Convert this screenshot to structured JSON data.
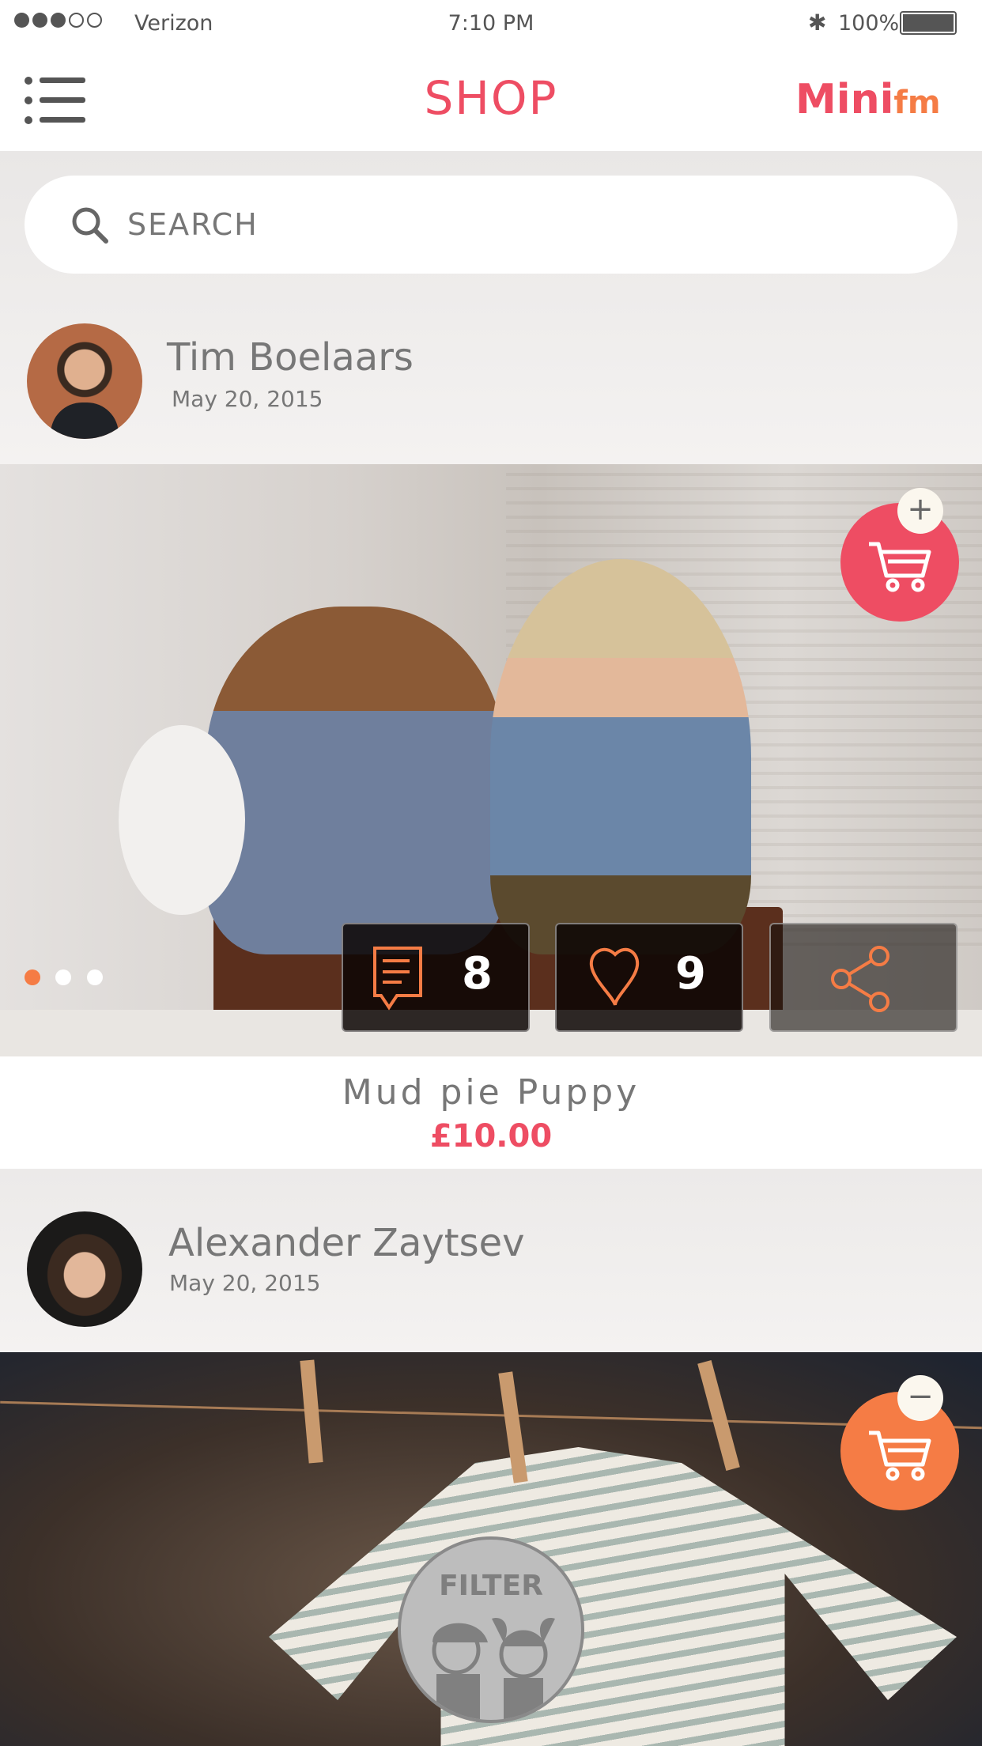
{
  "status": {
    "carrier": "Verizon",
    "signal_bars": 3,
    "time": "7:10 PM",
    "battery": "100%"
  },
  "header": {
    "title": "SHOP",
    "logo_text": "Minifm",
    "logo_colors": {
      "mini": "#ee4d63",
      "fm": "#f57c45"
    }
  },
  "search": {
    "placeholder": "SEARCH"
  },
  "posts": [
    {
      "author": "Tim Boelaars",
      "date": "May 20, 2015",
      "cart_action": "add",
      "comments": "8",
      "likes": "9",
      "carousel_index": 0,
      "carousel_count": 3,
      "product": "Mud pie Puppy",
      "price": "£10.00"
    },
    {
      "author": "Alexander Zaytsev",
      "date": "May 20, 2015",
      "cart_action": "remove"
    }
  ],
  "filter": {
    "label": "FILTER"
  },
  "colors": {
    "accent": "#ee4d63",
    "orange": "#f57c45",
    "text": "#777777"
  }
}
